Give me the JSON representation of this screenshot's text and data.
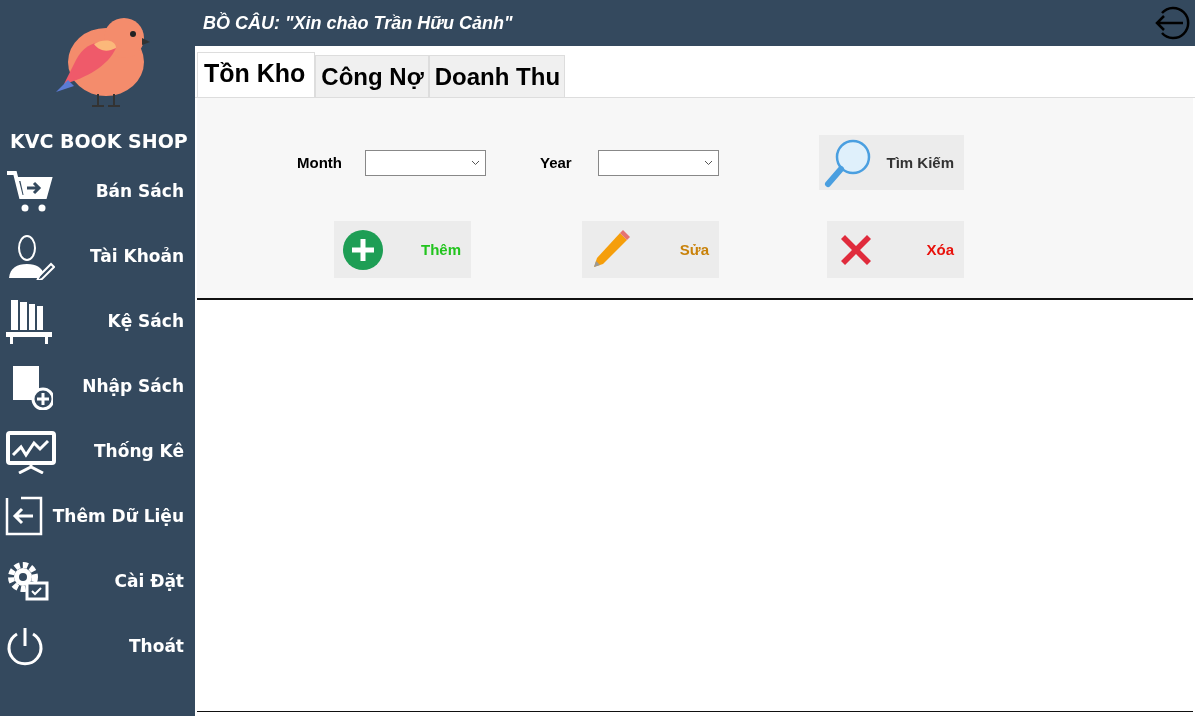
{
  "sidebar": {
    "shop_name": "KVC BOOK SHOP",
    "items": [
      {
        "label": "Bán Sách",
        "kind": "cart"
      },
      {
        "label": "Tài Khoản",
        "kind": "account"
      },
      {
        "label": "Kệ Sách",
        "kind": "shelf"
      },
      {
        "label": "Nhập Sách",
        "kind": "import"
      },
      {
        "label": "Thống Kê",
        "kind": "chart"
      },
      {
        "label": "Thêm Dữ Liệu",
        "kind": "data"
      },
      {
        "label": "Cài Đặt",
        "kind": "settings"
      },
      {
        "label": "Thoát",
        "kind": "power"
      }
    ]
  },
  "header": {
    "title": "BỒ CÂU: \"Xin chào Trần Hữu Cảnh\""
  },
  "tabs": [
    {
      "label": "Tồn Kho",
      "selected": true
    },
    {
      "label": "Công Nợ",
      "selected": false
    },
    {
      "label": "Doanh Thu",
      "selected": false
    }
  ],
  "filters": [
    {
      "label": "Month"
    },
    {
      "label": "Year"
    }
  ],
  "search_button": {
    "label": "Tìm Kiếm"
  },
  "actions": [
    {
      "label": "Thêm",
      "kind": "add",
      "color": "#22c41e"
    },
    {
      "label": "Sửa",
      "kind": "edit",
      "color": "#c9820a"
    },
    {
      "label": "Xóa",
      "kind": "delete",
      "color": "#e8120c"
    }
  ]
}
